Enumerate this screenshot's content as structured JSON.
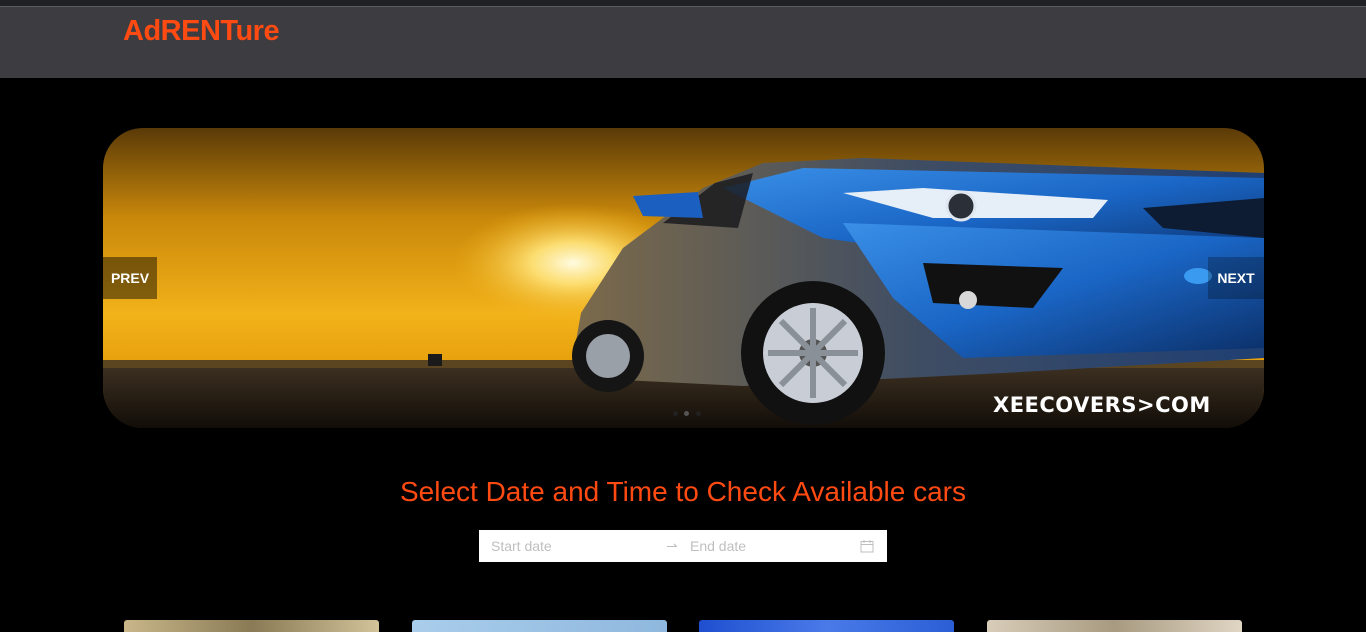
{
  "navbar": {
    "brand": "AdRENTure"
  },
  "carousel": {
    "prev_label": "PREV",
    "next_label": "NEXT",
    "watermark": "XEECOVERS>COM",
    "slide_count": 3,
    "active_slide": 1
  },
  "booking": {
    "heading": "Select Date and Time to Check Available cars",
    "start_placeholder": "Start date",
    "end_placeholder": "End date",
    "separator_icon": "swap-right-icon",
    "calendar_icon": "calendar-icon"
  },
  "colors": {
    "accent": "#ff4a12",
    "navbar": "#3d3c41",
    "background": "#000000"
  },
  "cars": [
    {
      "name": "car-card-1",
      "color": "#b8a77a"
    },
    {
      "name": "car-card-2",
      "color": "#9cc4e6"
    },
    {
      "name": "car-card-3",
      "color": "#2b5ed6"
    },
    {
      "name": "car-card-4",
      "color": "#cfc3b0"
    }
  ]
}
